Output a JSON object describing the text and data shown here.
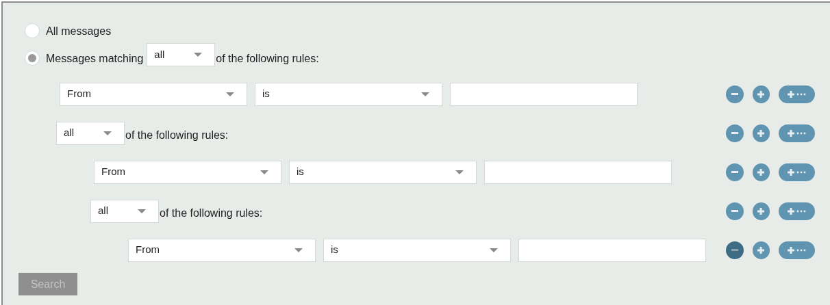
{
  "scope_options": [
    {
      "label": "All messages",
      "selected": false
    },
    {
      "label": "Messages matching",
      "selected": true,
      "match": "all",
      "suffix": "of the following rules:"
    }
  ],
  "rules": [
    {
      "kind": "rule",
      "field": "From",
      "operator": "is",
      "remove_pressed": false
    },
    {
      "kind": "group",
      "match": "all",
      "suffix": "of the following rules:",
      "remove_pressed": false,
      "children": [
        {
          "kind": "rule",
          "field": "From",
          "operator": "is",
          "remove_pressed": false
        },
        {
          "kind": "group",
          "match": "all",
          "suffix": "of the following rules:",
          "remove_pressed": false,
          "children": [
            {
              "kind": "rule",
              "field": "From",
              "operator": "is",
              "remove_pressed": true
            }
          ]
        }
      ]
    }
  ],
  "search_button": {
    "label": "Search",
    "disabled": true
  }
}
